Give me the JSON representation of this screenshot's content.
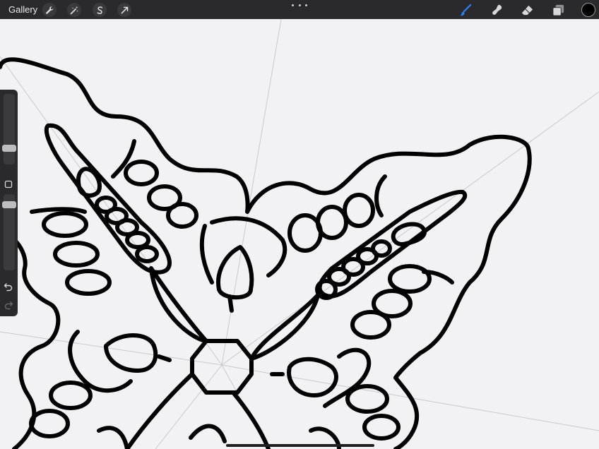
{
  "topbar": {
    "gallery_label": "Gallery",
    "left_tools": [
      "wrench-icon",
      "magic-wand-icon",
      "selection-icon",
      "transform-arrow-icon"
    ],
    "more_icon": "more-dots-icon",
    "right_tools": [
      "brush-icon",
      "smudge-icon",
      "eraser-icon",
      "layers-icon"
    ],
    "active_tool": "brush-icon",
    "active_color": "#000000",
    "accent": "#2f7df6"
  },
  "sidebar": {
    "tools": [
      "brush-size-slider",
      "modify-button",
      "opacity-slider",
      "undo-icon",
      "redo-icon"
    ]
  },
  "canvas": {
    "background": "#f2f2f4",
    "content": "symmetry-guide-mandala-drawing"
  }
}
